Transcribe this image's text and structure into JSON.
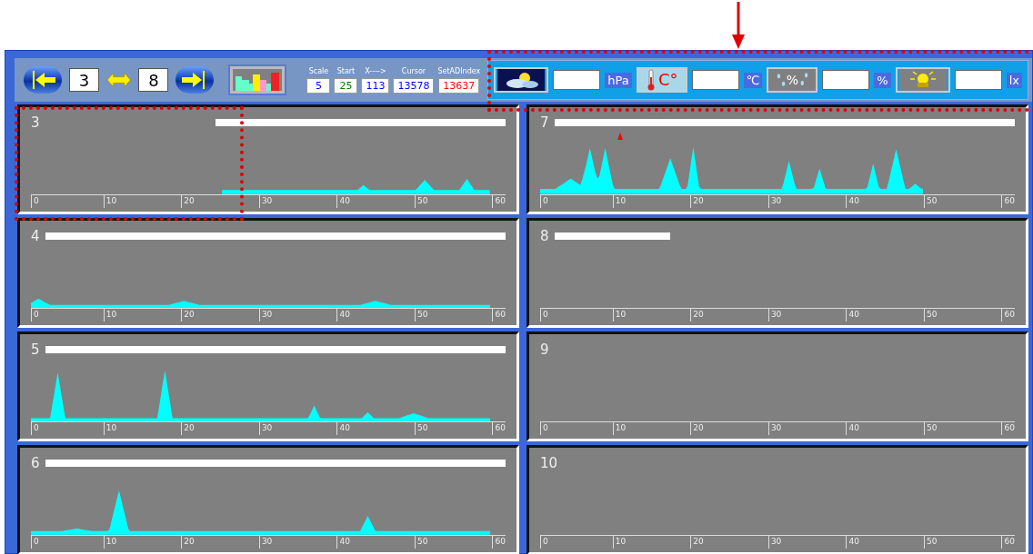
{
  "toolbar": {
    "from_value": "3",
    "to_value": "8",
    "readouts": [
      {
        "label": "Scale",
        "value": "5",
        "color": "#0000ff"
      },
      {
        "label": "Start",
        "value": "25",
        "color": "#008000"
      },
      {
        "label": "X---->",
        "value": "113",
        "color": "#0000ff"
      },
      {
        "label": "Cursor",
        "value": "13578",
        "color": "#0000ff"
      },
      {
        "label": "SetADIndex",
        "value": "13637",
        "color": "#ff0000"
      }
    ]
  },
  "sensors": [
    {
      "kind": "weather",
      "unit": "hPa"
    },
    {
      "kind": "temperature",
      "icon_text": "C°",
      "unit": "℃"
    },
    {
      "kind": "humidity",
      "icon_text": "%",
      "unit": "%"
    },
    {
      "kind": "light",
      "unit": "lx"
    }
  ],
  "panels": [
    {
      "number": "3",
      "bar": {
        "kind": "partial"
      },
      "trace": true,
      "marker": false,
      "ticks": [
        "0",
        "10",
        "20",
        "30",
        "40",
        "50",
        "60"
      ]
    },
    {
      "number": "4",
      "bar": {
        "kind": "full"
      },
      "trace": true,
      "marker": false,
      "ticks": [
        "0",
        "10",
        "20",
        "30",
        "40",
        "50",
        "60"
      ]
    },
    {
      "number": "5",
      "bar": {
        "kind": "full"
      },
      "trace": true,
      "marker": false,
      "ticks": [
        "0",
        "10",
        "20",
        "30",
        "40",
        "50",
        "60"
      ]
    },
    {
      "number": "6",
      "bar": {
        "kind": "full"
      },
      "trace": true,
      "marker": false,
      "ticks": [
        "0",
        "10",
        "20",
        "30",
        "40",
        "50",
        "60"
      ]
    },
    {
      "number": "7",
      "bar": {
        "kind": "full"
      },
      "trace": true,
      "marker": true,
      "ticks": [
        "0",
        "10",
        "20",
        "30",
        "40",
        "50",
        "60"
      ]
    },
    {
      "number": "8",
      "bar": {
        "kind": "short"
      },
      "trace": false,
      "marker": false,
      "ticks": [
        "0",
        "10",
        "20",
        "30",
        "40",
        "50",
        "60"
      ]
    },
    {
      "number": "9",
      "trace": false,
      "marker": false,
      "ticks": [
        "0",
        "10",
        "20",
        "30",
        "40",
        "50",
        "60"
      ]
    },
    {
      "number": "10",
      "trace": false,
      "marker": false,
      "ticks": [
        "0",
        "10",
        "20",
        "30",
        "40",
        "50",
        "60"
      ]
    }
  ]
}
